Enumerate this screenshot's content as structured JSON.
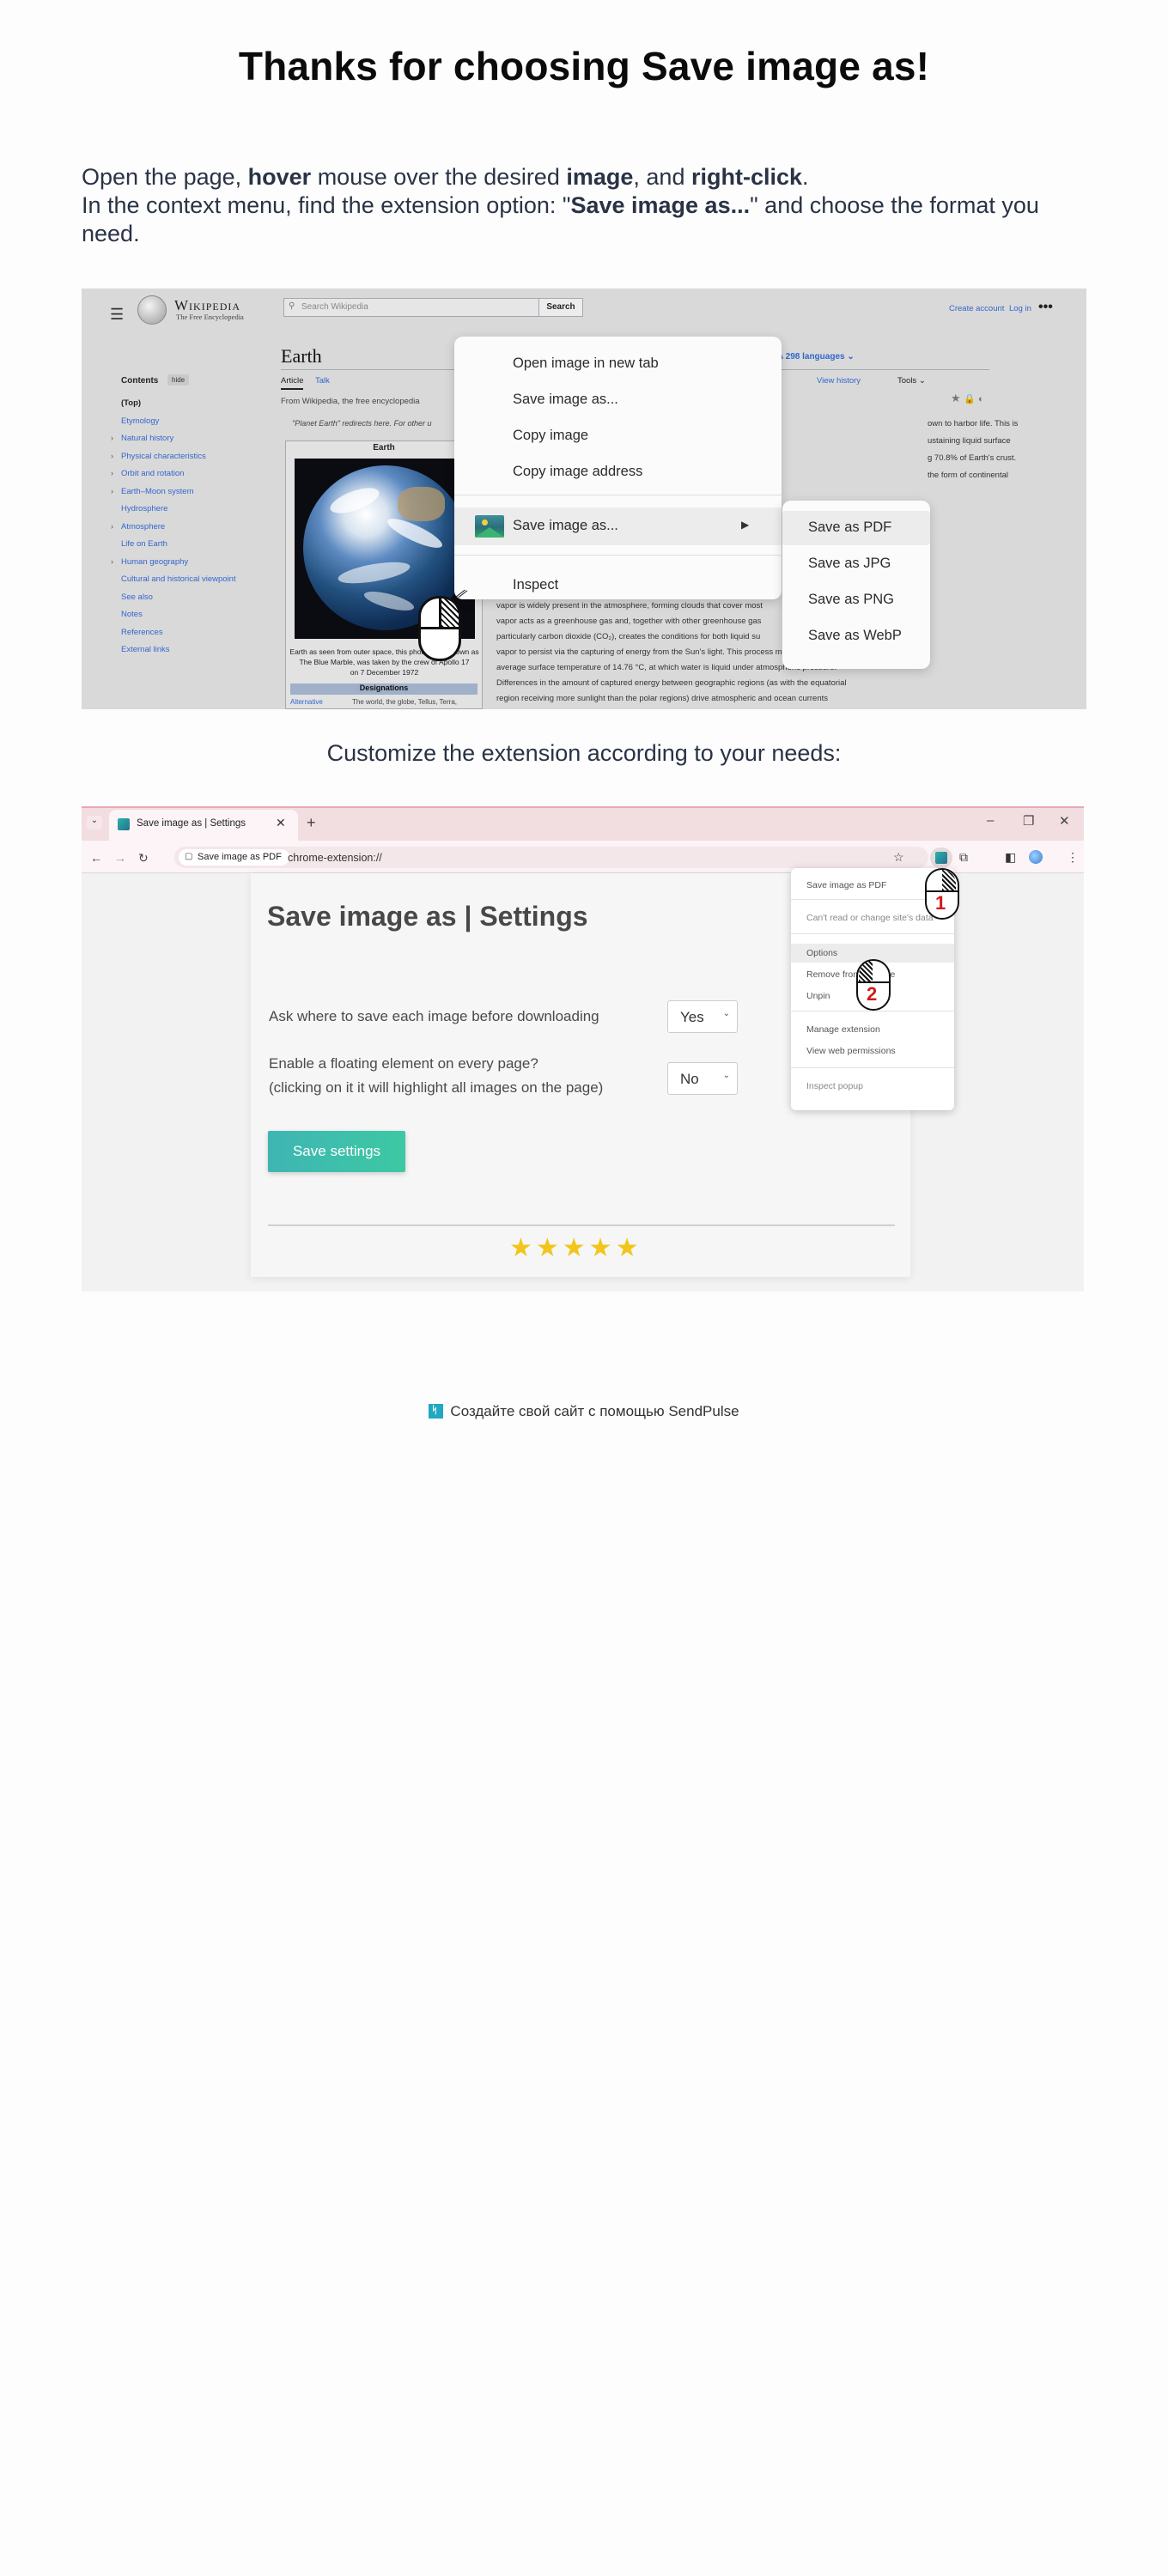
{
  "title": "Thanks for choosing Save image as!",
  "instructions": {
    "line1": [
      "Open the page, ",
      "hover",
      " mouse over the desired ",
      "image",
      ", and ",
      "right-click",
      "."
    ],
    "line2": [
      "In the context menu, find the extension option: \"",
      "Save image as...",
      "\" and choose the format you need."
    ]
  },
  "wikipedia": {
    "wordmark": "Wikipedia",
    "tagline": "The Free Encyclopedia",
    "search_placeholder": "Search Wikipedia",
    "search_button": "Search",
    "create_account": "Create account",
    "log_in": "Log in",
    "contents_heading": "Contents",
    "hide_label": "hide",
    "toc": [
      {
        "label": "(Top)",
        "chevron": false
      },
      {
        "label": "Etymology",
        "chevron": false
      },
      {
        "label": "Natural history",
        "chevron": true
      },
      {
        "label": "Physical characteristics",
        "chevron": true
      },
      {
        "label": "Orbit and rotation",
        "chevron": true
      },
      {
        "label": "Earth–Moon system",
        "chevron": true
      },
      {
        "label": "Hydrosphere",
        "chevron": false
      },
      {
        "label": "Atmosphere",
        "chevron": true
      },
      {
        "label": "Life on Earth",
        "chevron": false
      },
      {
        "label": "Human geography",
        "chevron": true
      },
      {
        "label": "Cultural and historical viewpoint",
        "chevron": false
      },
      {
        "label": "See also",
        "chevron": false
      },
      {
        "label": "Notes",
        "chevron": false
      },
      {
        "label": "References",
        "chevron": false
      },
      {
        "label": "External links",
        "chevron": false
      }
    ],
    "article_title": "Earth",
    "tab_article": "Article",
    "tab_talk": "Talk",
    "languages": "298 languages",
    "view_history": "View history",
    "tools": "Tools",
    "from_line": "From Wikipedia, the free encyclopedia",
    "redirect_note": "\"Planet Earth\" redirects here. For other u",
    "infobox_title": "Earth",
    "caption_lines": [
      "Earth as seen from outer space, this photograph known as",
      "The Blue Marble, was taken by the crew of Apollo 17",
      "on 7 December 1972"
    ],
    "designations": "Designations",
    "alt_label": "Alternative",
    "alt_value": "The world, the globe, Tellus, Terra,",
    "body_right": [
      "own to harbor life. This is",
      "ustaining liquid surface",
      "g 70.8% of Earth's crust.",
      "the form of continental"
    ],
    "body_bottom": [
      "vapor is widely present in the atmosphere, forming clouds that cover most",
      "vapor acts as a greenhouse gas and, together with other greenhouse gas",
      "particularly carbon dioxide (CO₂), creates the conditions for both liquid su",
      "vapor to persist via the capturing of energy from the Sun's light. This process maintains the current",
      "average surface temperature of 14.76 °C, at which water is liquid under atmospheric pressure.",
      "Differences in the amount of captured energy between geographic regions (as with the equatorial",
      "region receiving more sunlight than the polar regions) drive atmospheric and ocean currents"
    ]
  },
  "context_menu": {
    "items": [
      "Open image in new tab",
      "Save image as...",
      "Copy image",
      "Copy image address"
    ],
    "extension_item": "Save image as...",
    "inspect": "Inspect",
    "submenu": [
      "Save as PDF",
      "Save as JPG",
      "Save as PNG",
      "Save as WebP"
    ]
  },
  "customize_text": "Customize the extension according to your needs:",
  "browser": {
    "tab_title": "Save image as | Settings",
    "chip_label": "Save image as PDF",
    "url": "chrome-extension://",
    "settings_title": "Save image as | Settings",
    "setting1_label": "Ask where to save each image before downloading",
    "setting1_value": "Yes",
    "setting2_label_line1": "Enable a floating element on every page?",
    "setting2_label_line2": "(clicking on it it will highlight all images on the page)",
    "setting2_value": "No",
    "save_button": "Save settings",
    "stars": "★★★★★",
    "ext_menu": {
      "header": "Save image as PDF",
      "cant_read": "Can't read or change site's data",
      "options": "Options",
      "remove": "Remove from Chrome",
      "unpin": "Unpin",
      "manage": "Manage extension",
      "permissions": "View web permissions",
      "inspect_popup": "Inspect popup"
    },
    "step1": "1",
    "step2": "2"
  },
  "footer": {
    "text": "Создайте свой сайт с помощью SendPulse",
    "brand_color": "#20a9c0"
  },
  "colors": {
    "heading": "#0b0b0b",
    "text": "#2a3345",
    "wiki_link": "#3366cc",
    "save_button_gradient": [
      "#3eb5b3",
      "#3dc9a3"
    ],
    "star": "#f2c51a",
    "step_number": "#d11a1a"
  }
}
